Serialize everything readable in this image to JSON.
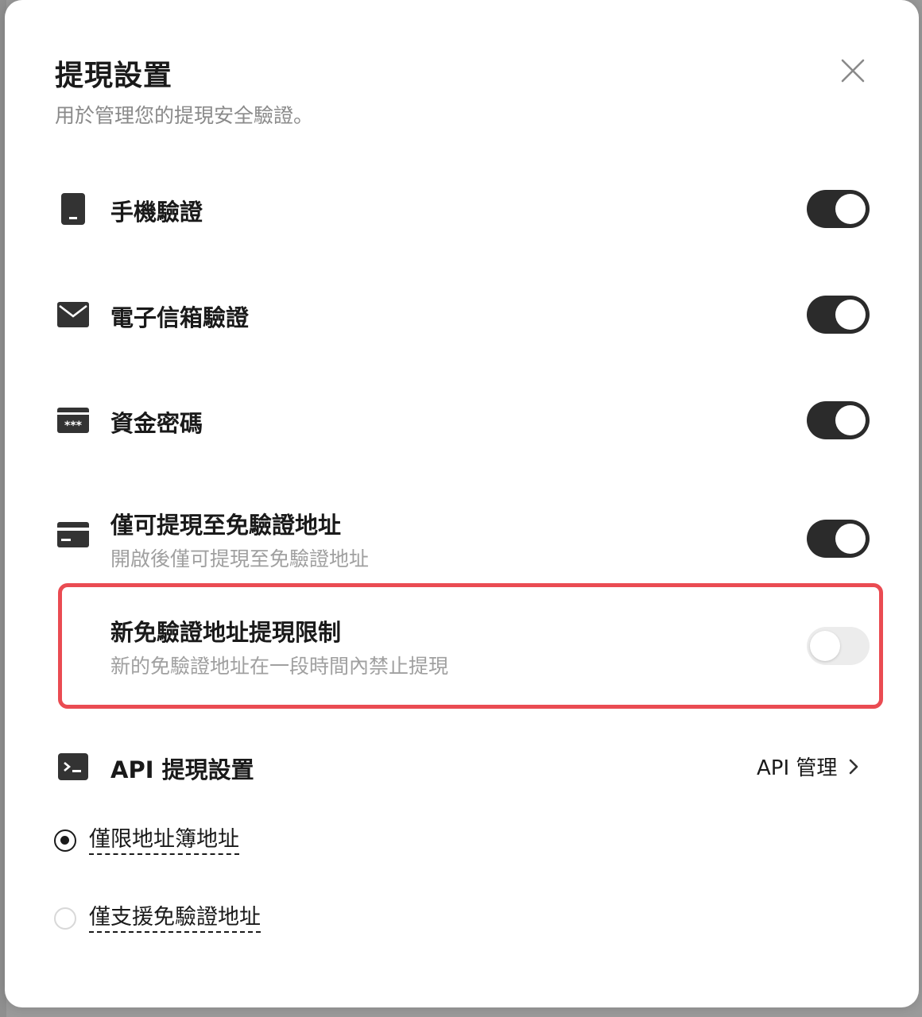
{
  "dialog": {
    "title": "提現設置",
    "subtitle": "用於管理您的提現安全驗證。"
  },
  "settings": [
    {
      "icon": "phone-icon",
      "label": "手機驗證",
      "enabled": true
    },
    {
      "icon": "email-icon",
      "label": "電子信箱驗證",
      "enabled": true
    },
    {
      "icon": "fund-password-icon",
      "label": "資金密碼",
      "enabled": true
    },
    {
      "icon": "card-icon",
      "label": "僅可提現至免驗證地址",
      "description": "開啟後僅可提現至免驗證地址",
      "enabled": true
    },
    {
      "label": "新免驗證地址提現限制",
      "description": "新的免驗證地址在一段時間內禁止提現",
      "enabled": false
    }
  ],
  "api": {
    "icon": "terminal-icon",
    "label": "API 提現設置",
    "link_label": "API 管理"
  },
  "radio_options": [
    {
      "label": "僅限地址簿地址",
      "selected": true
    },
    {
      "label": "僅支援免驗證地址",
      "selected": false
    }
  ],
  "colors": {
    "toggle_on": "#2b2b2b",
    "toggle_off": "#ececec",
    "highlight": "#ea4b52"
  }
}
